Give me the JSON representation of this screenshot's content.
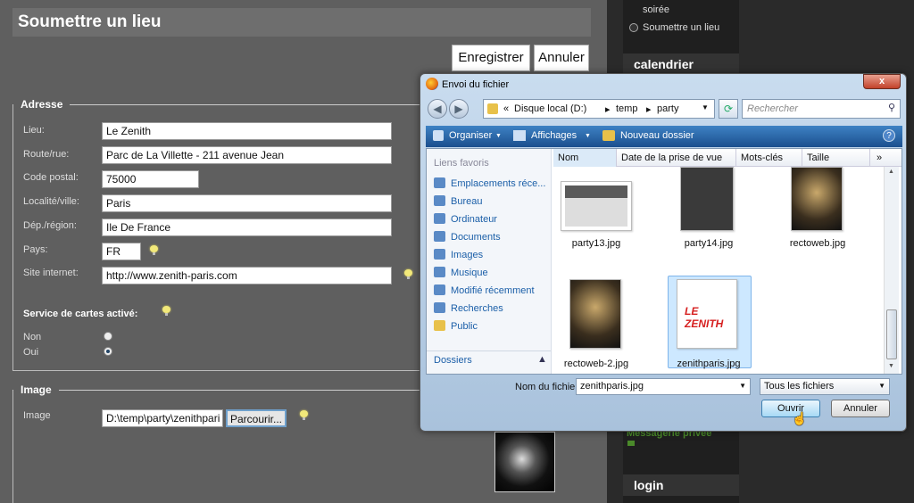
{
  "page": {
    "title": "Soumettre un lieu",
    "save_label": "Enregistrer",
    "cancel_label": "Annuler"
  },
  "address": {
    "legend": "Adresse",
    "fields": [
      {
        "label": "Lieu:",
        "value": "Le Zenith"
      },
      {
        "label": "Route/rue:",
        "value": "Parc de La Villette - 211 avenue Jean"
      },
      {
        "label": "Code postal:",
        "value": "75000"
      },
      {
        "label": "Localité/ville:",
        "value": "Paris"
      },
      {
        "label": "Dép./région:",
        "value": "Ile De France"
      },
      {
        "label": "Pays:",
        "value": "FR"
      },
      {
        "label": "Site internet:",
        "value": "http://www.zenith-paris.com"
      }
    ],
    "map_service": {
      "label": "Service de cartes activé:",
      "options": [
        "Non",
        "Oui"
      ],
      "selected": "Oui"
    }
  },
  "image": {
    "legend": "Image",
    "label": "Image",
    "path_value": "D:\\temp\\party\\zenithpari",
    "browse_label": "Parcourir..."
  },
  "right": {
    "item1": "soirée",
    "item2": "Soumettre un lieu",
    "calendar": "calendrier",
    "messages": "Messagerie privée",
    "login": "login"
  },
  "dialog": {
    "title": "Envoi du fichier",
    "close": "x",
    "path": [
      "Disque local (D:)",
      "temp",
      "party"
    ],
    "search_placeholder": "Rechercher",
    "toolbar": {
      "organize": "Organiser",
      "views": "Affichages",
      "new_folder": "Nouveau dossier"
    },
    "nav": {
      "header": "Liens favoris",
      "items": [
        "Emplacements réce...",
        "Bureau",
        "Ordinateur",
        "Documents",
        "Images",
        "Musique",
        "Modifié récemment",
        "Recherches",
        "Public"
      ],
      "folders": "Dossiers"
    },
    "columns": [
      "Nom",
      "Date de la prise de vue",
      "Mots-clés",
      "Taille"
    ],
    "files": [
      "party13.jpg",
      "party14.jpg",
      "rectoweb.jpg",
      "rectoweb-2.jpg",
      "zenithparis.jpg"
    ],
    "filename_label": "Nom du fichier :",
    "filename_value": "zenithparis.jpg",
    "filetype": "Tous les fichiers",
    "open_label": "Ouvrir",
    "cancel_label": "Annuler"
  },
  "colors": {
    "page_bg": "#5f5f5f",
    "dialog_accent": "#1b4f8e",
    "selection": "#cde8ff"
  }
}
